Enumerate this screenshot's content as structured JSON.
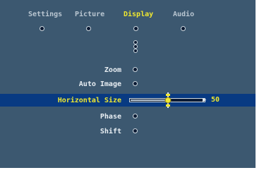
{
  "menu": {
    "tabs": [
      {
        "label": "Settings",
        "active": false
      },
      {
        "label": "Picture",
        "active": false
      },
      {
        "label": "Display",
        "active": true
      },
      {
        "label": "Audio",
        "active": false
      }
    ],
    "active_tab": "Display"
  },
  "items": [
    {
      "label": "Zoom",
      "highlighted": false
    },
    {
      "label": "Auto Image",
      "highlighted": false
    },
    {
      "label": "Horizontal Size",
      "highlighted": true
    },
    {
      "label": "Phase",
      "highlighted": false
    },
    {
      "label": "Shift",
      "highlighted": false
    }
  ],
  "slider": {
    "value": "50",
    "fraction": 0.5,
    "left_arrow": "◀",
    "right_arrow": "▶"
  },
  "colors": {
    "background": "#3c5870",
    "highlight_bar": "#083a82",
    "active_text": "#f0e830",
    "text": "#e8eef3",
    "inactive_tab": "#b9c6d1"
  }
}
